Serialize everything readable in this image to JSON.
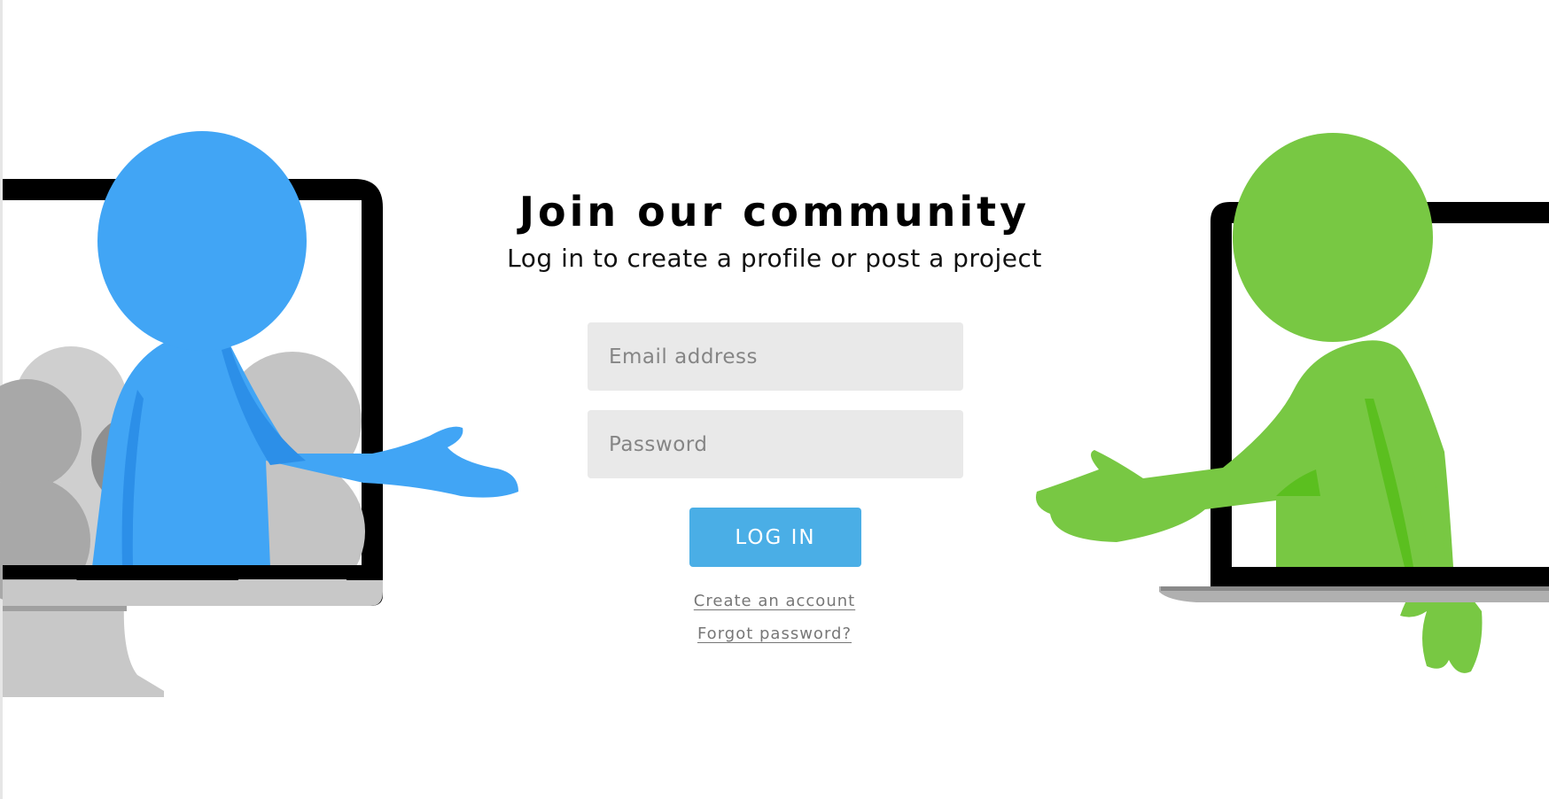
{
  "hero": {
    "title": "Join our community",
    "subtitle": "Log in to create a profile or post a project"
  },
  "form": {
    "email_placeholder": "Email address",
    "password_placeholder": "Password",
    "login_label": "LOG IN",
    "create_account_label": "Create an account",
    "forgot_password_label": "Forgot password?"
  },
  "colors": {
    "login_button": "#4aaee6",
    "input_background": "#e9e9e9",
    "blue_figure": "#41a5f5",
    "green_figure": "#78c843"
  }
}
